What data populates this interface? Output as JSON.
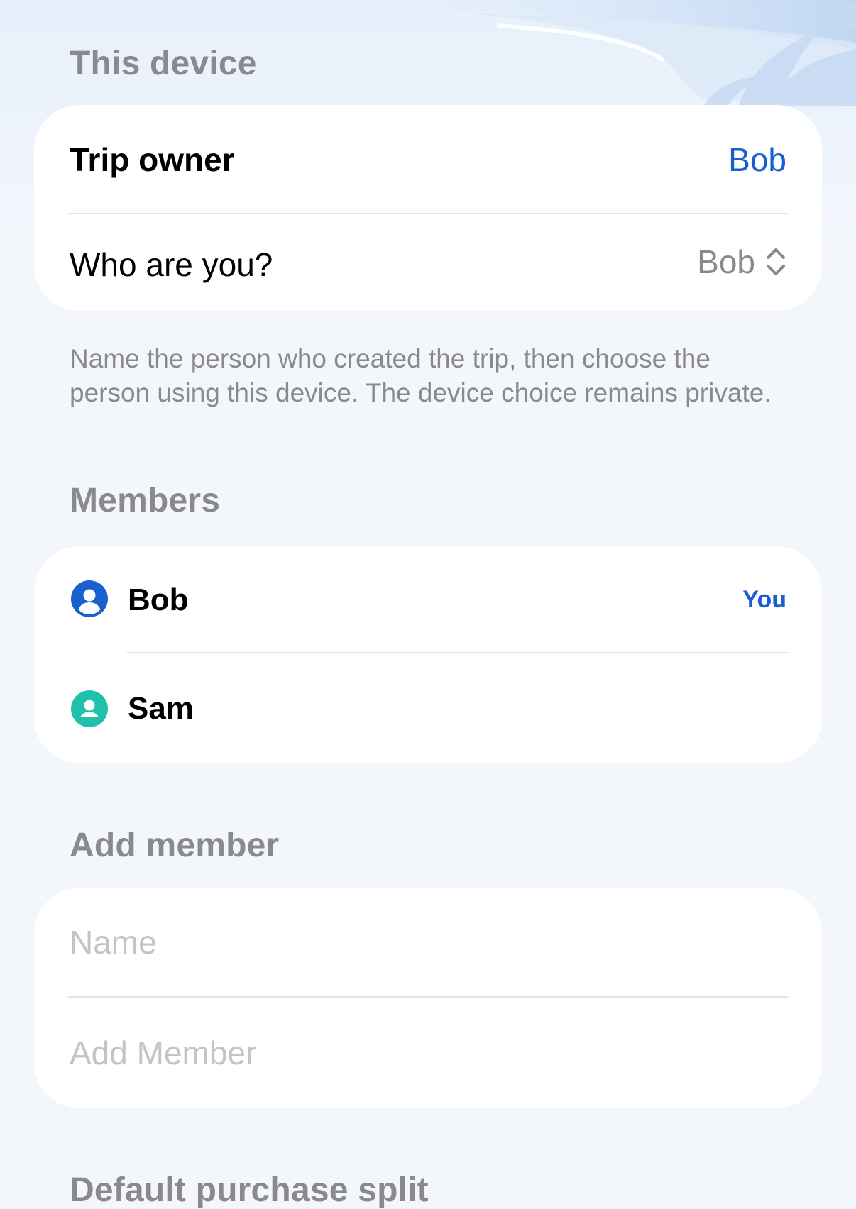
{
  "device_section": {
    "header": "This device",
    "trip_owner_label": "Trip owner",
    "trip_owner_value": "Bob",
    "who_label": "Who are you?",
    "who_value": "Bob",
    "footnote": "Name the person who created the trip, then choose the person using this device. The device choice remains private."
  },
  "members_section": {
    "header": "Members",
    "members": [
      {
        "name": "Bob",
        "badge": "You",
        "avatar_color": "#1a5fd0",
        "icon": "person-circle-icon"
      },
      {
        "name": "Sam",
        "badge": "",
        "avatar_color": "#1fc1ac",
        "icon": "person-circle-icon"
      }
    ]
  },
  "add_member_section": {
    "header": "Add member",
    "name_placeholder": "Name",
    "name_value": "",
    "add_placeholder": "Add Member"
  },
  "split_section": {
    "header": "Default purchase split"
  },
  "colors": {
    "accent": "#1a5fd0",
    "secondary_text": "#8a8a8e",
    "placeholder": "#c4c4c8",
    "card": "#ffffff",
    "background": "#f3f7fc"
  }
}
